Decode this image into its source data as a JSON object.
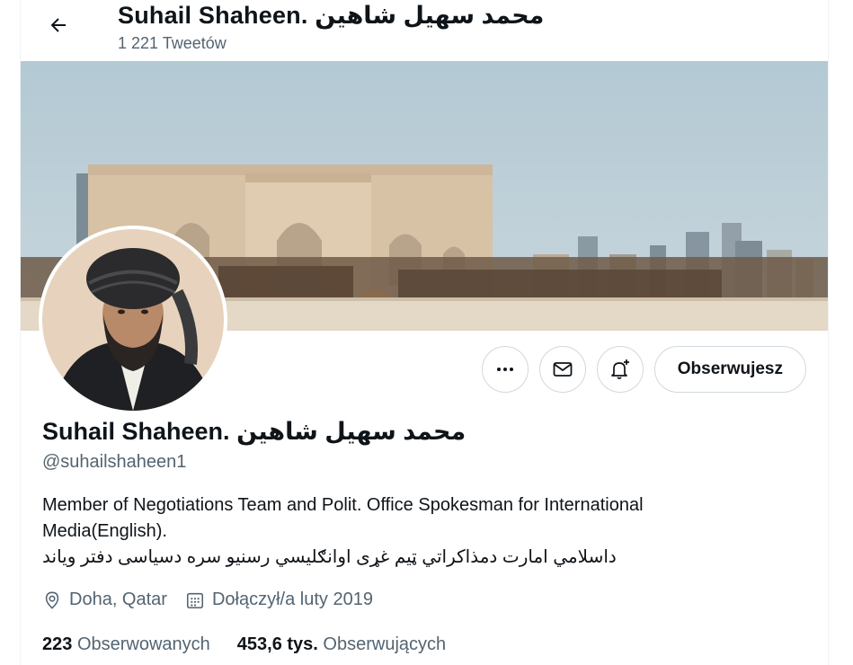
{
  "header": {
    "title": "Suhail Shaheen. محمد سهیل شاهین",
    "tweet_count": "1 221 Tweetów"
  },
  "profile": {
    "name": "Suhail Shaheen. محمد سهیل شاهین",
    "handle": "@suhailshaheen1",
    "bio_line1": "Member of Negotiations Team and Polit. Office Spokesman for International Media(English).",
    "bio_line2": "داسلامي امارت دمذاکراتي ټیم غړی اوانګلیسي رسنیو سره دسیاسی دفتر ویاند",
    "location": "Doha, Qatar",
    "joined": "Dołączył/a luty 2019"
  },
  "actions": {
    "more_icon": "more-icon",
    "message_icon": "envelope-icon",
    "notify_icon": "bell-plus-icon",
    "follow_label": "Obserwujesz"
  },
  "stats": {
    "following_count": "223",
    "following_label": "Obserwowanych",
    "followers_count": "453,6 tys.",
    "followers_label": "Obserwujących"
  },
  "colors": {
    "text_primary": "#0f1419",
    "text_secondary": "#536471",
    "border": "#cfd9de",
    "sky": "#b8ccd6"
  }
}
